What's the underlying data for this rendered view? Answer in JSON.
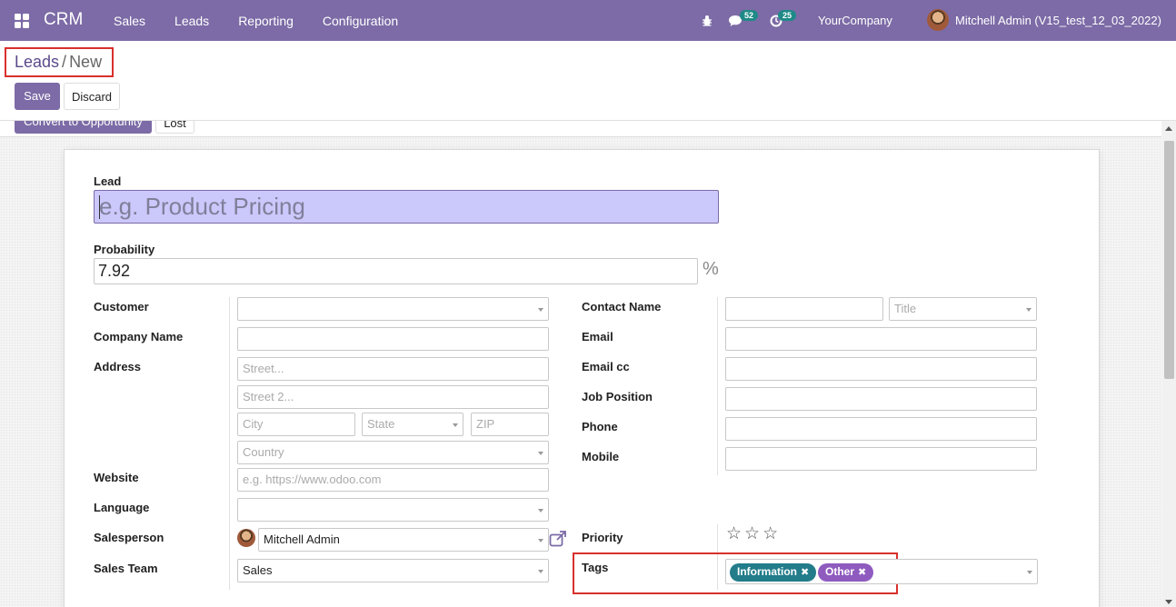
{
  "navbar": {
    "brand": "CRM",
    "menu": [
      "Sales",
      "Leads",
      "Reporting",
      "Configuration"
    ],
    "messages_count": "52",
    "activities_count": "25",
    "company": "YourCompany",
    "user": "Mitchell Admin (V15_test_12_03_2022)"
  },
  "breadcrumb": {
    "parent": "Leads",
    "separator": "/",
    "current": "New"
  },
  "buttons": {
    "save": "Save",
    "discard": "Discard",
    "convert": "Convert to Opportunity",
    "lost": "Lost"
  },
  "form": {
    "lead_label": "Lead",
    "lead_placeholder": "e.g. Product Pricing",
    "probability_label": "Probability",
    "probability_value": "7.92",
    "percent": "%",
    "left": {
      "customer": "Customer",
      "company_name": "Company Name",
      "address": "Address",
      "street_ph": "Street...",
      "street2_ph": "Street 2...",
      "city_ph": "City",
      "state_ph": "State",
      "zip_ph": "ZIP",
      "country_ph": "Country",
      "website": "Website",
      "website_ph": "e.g. https://www.odoo.com",
      "language": "Language",
      "salesperson": "Salesperson",
      "salesperson_value": "Mitchell Admin",
      "sales_team": "Sales Team",
      "sales_team_value": "Sales"
    },
    "right": {
      "contact_name": "Contact Name",
      "title_ph": "Title",
      "email": "Email",
      "email_cc": "Email cc",
      "job_position": "Job Position",
      "phone": "Phone",
      "mobile": "Mobile",
      "priority": "Priority",
      "priority_stars": 0,
      "tags": "Tags",
      "tag_values": [
        "Information",
        "Other"
      ]
    }
  },
  "colors": {
    "navbar": "#7c6ba6",
    "tag_information": "#227c8a",
    "tag_other": "#8f5bbf",
    "highlight_border": "#d9302c"
  }
}
